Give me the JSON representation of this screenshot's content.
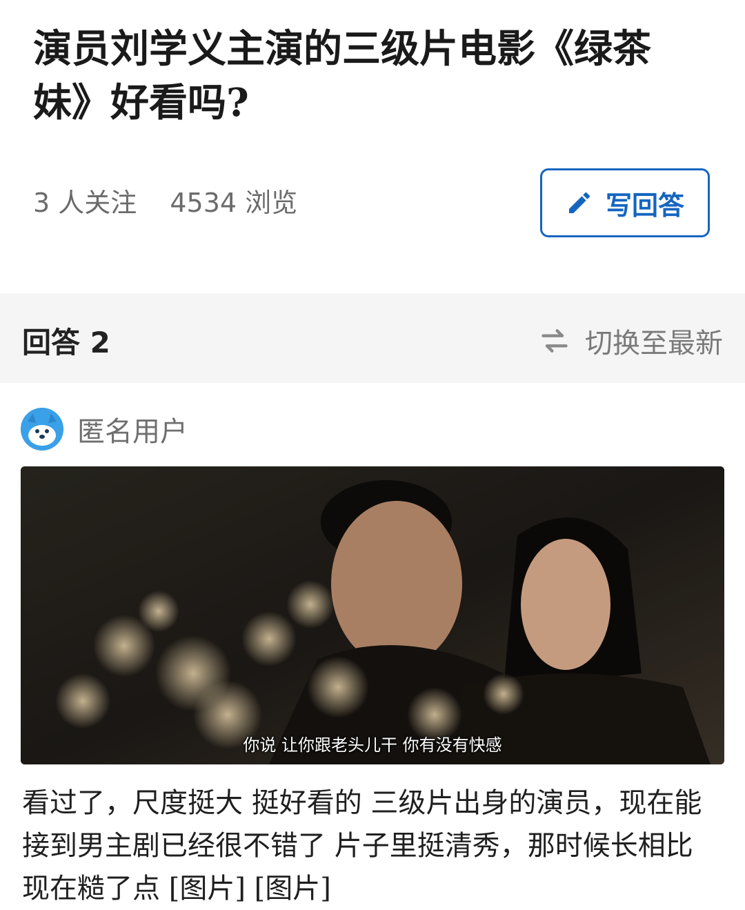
{
  "question": {
    "title": "演员刘学义主演的三级片电影《绿茶妹》好看吗?",
    "followers": "3 人关注",
    "views": "4534 浏览",
    "write_answer_label": "写回答"
  },
  "answers_bar": {
    "count_label": "回答 2",
    "sort_label": "切换至最新"
  },
  "answer": {
    "author": "匿名用户",
    "image_subtitle": "你说  让你跟老头儿干  你有没有快感",
    "text": "看过了，尺度挺大 挺好看的 三级片出身的演员，现在能接到男主剧已经很不错了 片子里挺清秀，那时候长相比现在糙了点 [图片] [图片]"
  },
  "colors": {
    "accent": "#1565c0",
    "bar_bg": "#f5f5f5",
    "meta_text": "#6b6b6b"
  },
  "icons": {
    "write": "pencil-icon",
    "sort": "swap-arrows-icon",
    "avatar": "anonymous-avatar-icon"
  }
}
